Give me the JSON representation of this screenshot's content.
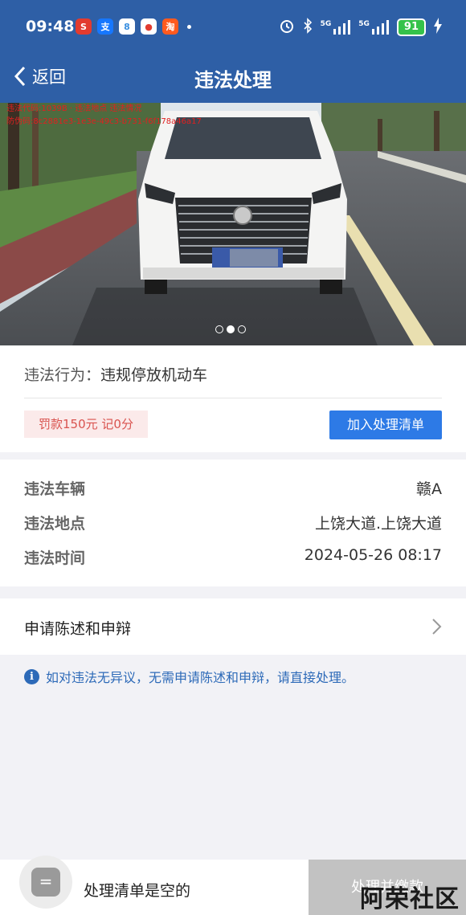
{
  "status_bar": {
    "time": "09:48",
    "apps": [
      {
        "icon": "app-red-icon",
        "glyph": "S",
        "bg": "#e23b2f",
        "color": "#fff"
      },
      {
        "icon": "alipay-icon",
        "glyph": "支",
        "bg": "#1677ff",
        "color": "#fff"
      },
      {
        "icon": "app-colorful-icon",
        "glyph": "8",
        "bg": "#ffffff",
        "color": "#3a8fe0"
      },
      {
        "icon": "map-pin-icon",
        "glyph": "●",
        "bg": "#ffffff",
        "color": "#e23b2f"
      },
      {
        "icon": "taobao-icon",
        "glyph": "淘",
        "bg": "#ff5a1f",
        "color": "#fff"
      }
    ],
    "network1": "5G",
    "network2": "5G",
    "battery": "91"
  },
  "nav": {
    "back_label": "返回",
    "title": "违法处理"
  },
  "photo": {
    "watermark_line1": "违法代码:1039B · 违法地点 违法情况",
    "watermark_line2": "防伪码:8c2881e3-1e3e-49c3-b731-f6f178a46a17",
    "pages": 3,
    "active_page": 2
  },
  "violation": {
    "behavior_label": "违法行为：",
    "behavior_value": "违规停放机动车",
    "fine": "罚款150元 记0分",
    "add_button": "加入处理清单"
  },
  "details": [
    {
      "key": "违法车辆",
      "value": "赣A"
    },
    {
      "key": "违法地点",
      "value": "上饶大道.上饶大道"
    },
    {
      "key": "违法时间",
      "value": "2024-05-26 08:17"
    }
  ],
  "appeal": {
    "label": "申请陈述和申辩"
  },
  "notice": {
    "text": "如对违法无异议，无需申请陈述和申辩，请直接处理。"
  },
  "bottom_bar": {
    "cart_glyph": "=",
    "empty_text": "处理清单是空的",
    "process_button": "处理并缴款"
  },
  "corner_watermark": "阿荣社区",
  "colors": {
    "header": "#2e5fa6",
    "primary_button": "#2d7ae6",
    "fine_text": "#d9534f",
    "notice": "#2d6ab8"
  }
}
